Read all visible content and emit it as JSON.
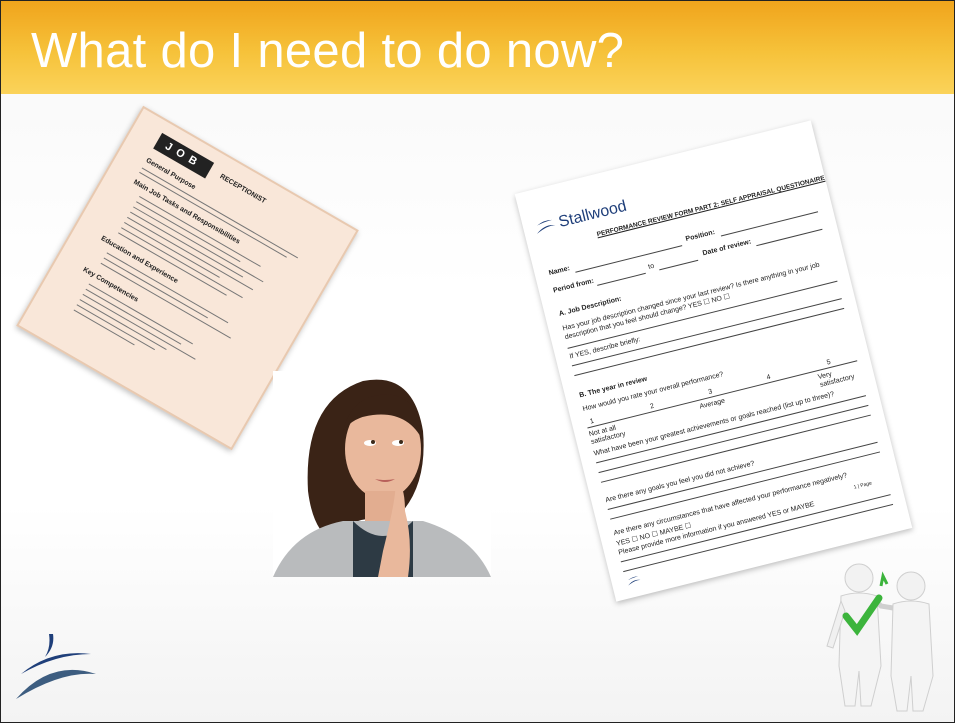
{
  "slide": {
    "title": "What do I need to do now?"
  },
  "job_doc": {
    "logo": "JOB",
    "heading": "RECEPTIONIST",
    "section1": "General Purpose",
    "section2": "Main Job Tasks and Responsibilities",
    "section3": "Education and Experience",
    "section4": "Key Competencies"
  },
  "review_doc": {
    "brand": "Stallwood",
    "form_title": "PERFORMANCE REVIEW FORM PART 2: SELF APPRAISAL QUESTIONAIRE",
    "name_label": "Name:",
    "position_label": "Position:",
    "period_label": "Period from:",
    "to_label": "to",
    "date_label": "Date of review:",
    "section_a": "A.  Job Description:",
    "q_a1": "Has your job description changed since your last review? Is there anything in your job description that you feel should change?  YES ☐ NO ☐",
    "q_a2": "If YES, describe briefly:",
    "section_b": "B.  The year in review",
    "q_b1": "How would you rate your overall performance?",
    "scale_low": "Not at all satisfactory",
    "scale_mid": "Average",
    "scale_high": "Very satisfactory",
    "q_b2": "What have been your greatest achievements or goals reached (list up to three)?",
    "q_b3": "Are there any goals you feel you did not achieve?",
    "q_b4": "Are there any circumstances that have affected your performance negatively?",
    "q_b4_opts": "YES ☐        NO ☐        MAYBE ☐",
    "q_b5": "Please provide more information if you answered YES or MAYBE",
    "page_num": "1 | Page"
  },
  "colors": {
    "title_bar": "#f2ae25",
    "logo_blue": "#1f3f7a",
    "check_green": "#3cb43c"
  }
}
